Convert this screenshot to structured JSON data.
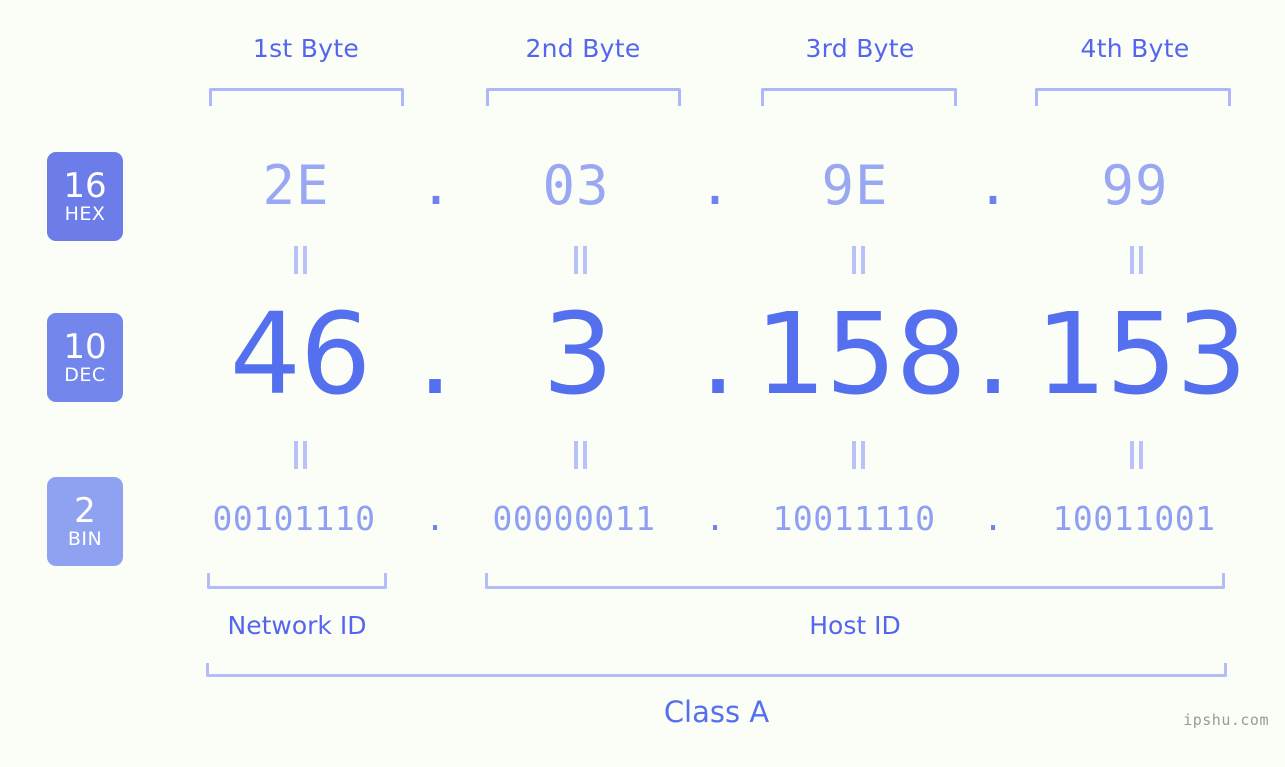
{
  "background_color": "#fbfdf7",
  "accent_colors": {
    "label_blue": "#5566ee",
    "bracket_blue": "#b3bdf8",
    "hex_value": "#9aa8f4",
    "dec_value": "#5570ee",
    "bin_value": "#8fa0f3",
    "badge_hex": "#6c7ce8",
    "badge_dec": "#7286ec",
    "badge_bin": "#8fa2f2"
  },
  "byte_headers": [
    {
      "label": "1st Byte"
    },
    {
      "label": "2nd Byte"
    },
    {
      "label": "3rd Byte"
    },
    {
      "label": "4th Byte"
    }
  ],
  "rows": {
    "hex": {
      "badge_number": "16",
      "badge_unit": "HEX",
      "values": [
        "2E",
        "03",
        "9E",
        "99"
      ],
      "separator": "."
    },
    "dec": {
      "badge_number": "10",
      "badge_unit": "DEC",
      "values": [
        "46",
        "3",
        "158",
        "153"
      ],
      "separator": "."
    },
    "bin": {
      "badge_number": "2",
      "badge_unit": "BIN",
      "values": [
        "00101110",
        "00000011",
        "10011110",
        "10011001"
      ],
      "separator": "."
    }
  },
  "equals_symbol": "=",
  "segments": {
    "network_id_label": "Network ID",
    "host_id_label": "Host ID"
  },
  "class_label": "Class A",
  "watermark": "ipshu.com"
}
